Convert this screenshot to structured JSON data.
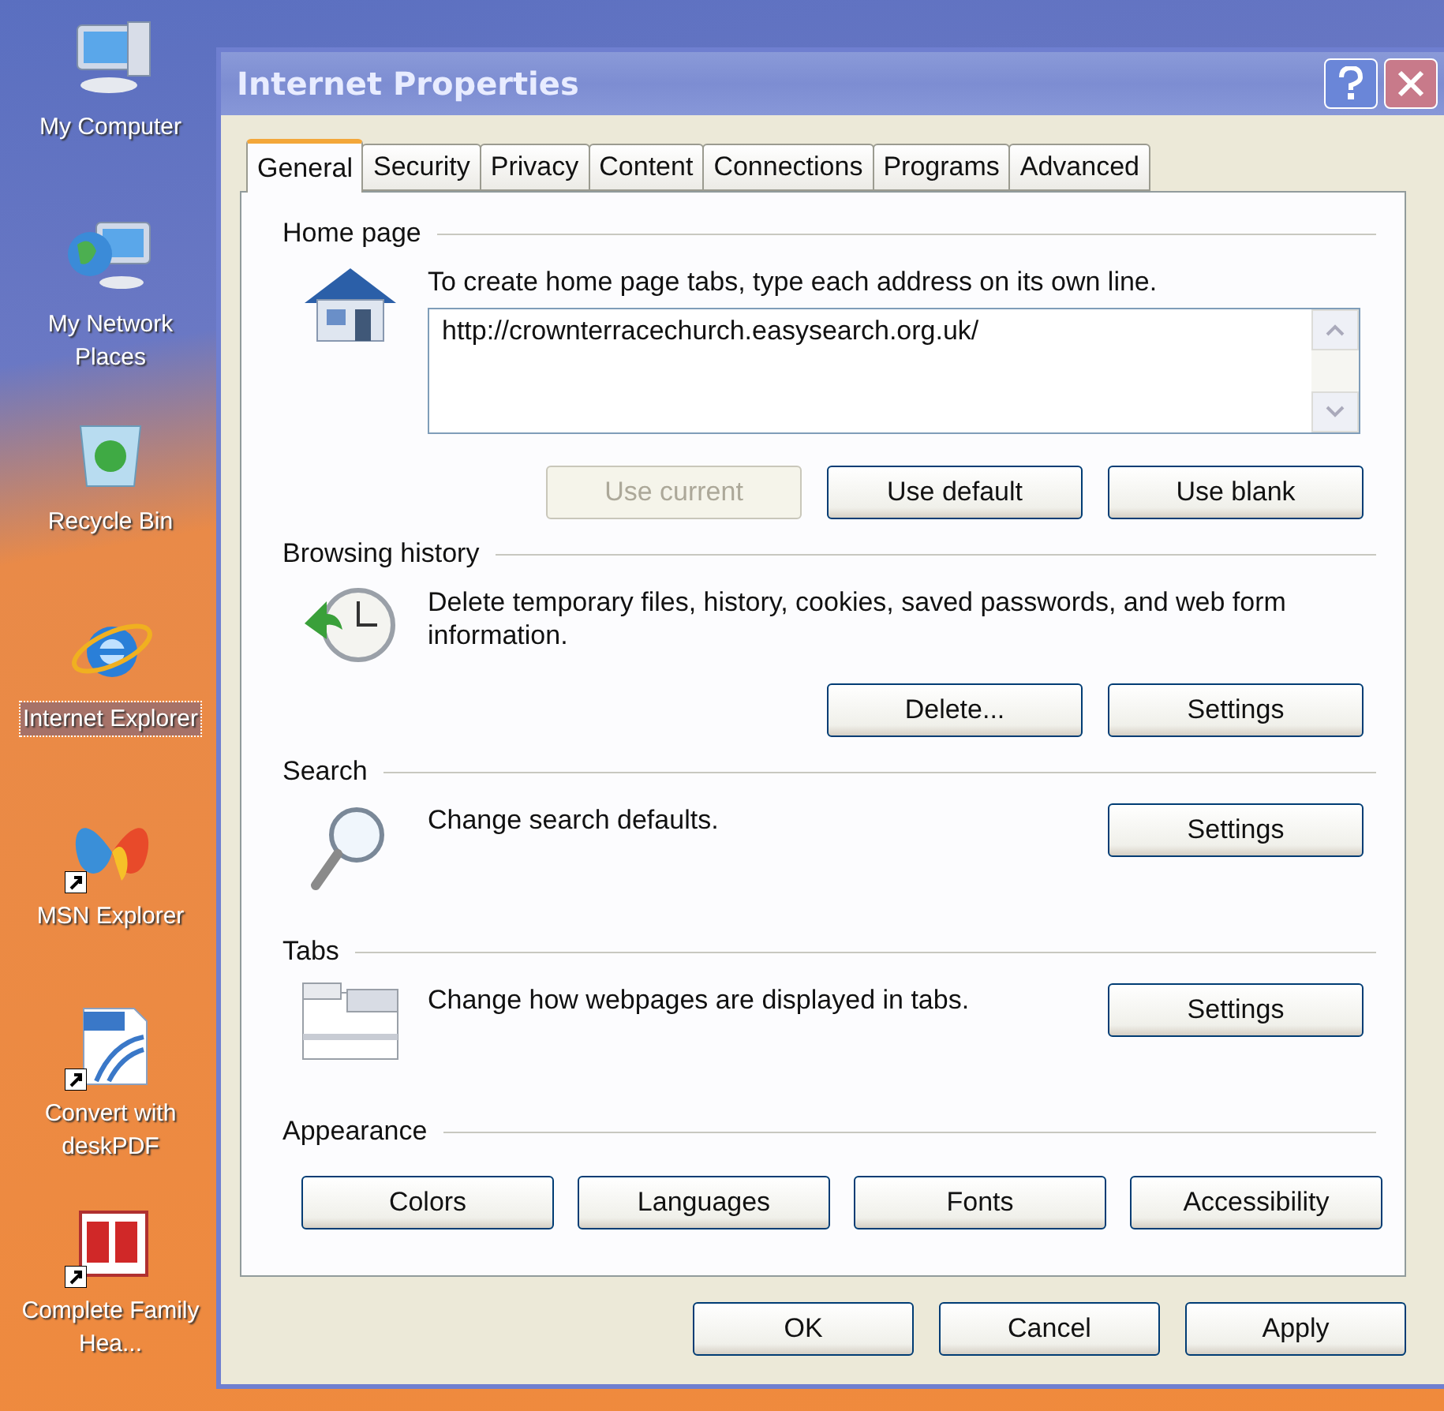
{
  "desktop": {
    "icons": [
      {
        "kind": "computer",
        "label": "My Computer",
        "shortcut": false,
        "selected": false
      },
      {
        "kind": "network",
        "label": "My Network Places",
        "shortcut": false,
        "selected": false
      },
      {
        "kind": "bin",
        "label": "Recycle Bin",
        "shortcut": false,
        "selected": false
      },
      {
        "kind": "browser",
        "label": "Internet Explorer",
        "shortcut": false,
        "selected": true
      },
      {
        "kind": "butterfly",
        "label": "MSN Explorer",
        "shortcut": true,
        "selected": false
      },
      {
        "kind": "pdf",
        "label": "Convert with deskPDF",
        "shortcut": true,
        "selected": false
      },
      {
        "kind": "book",
        "label": "Complete Family Hea...",
        "shortcut": true,
        "selected": false
      }
    ]
  },
  "window": {
    "title": "Internet Properties",
    "tabs": [
      {
        "label": "General",
        "selected": true
      },
      {
        "label": "Security",
        "selected": false
      },
      {
        "label": "Privacy",
        "selected": false
      },
      {
        "label": "Content",
        "selected": false
      },
      {
        "label": "Connections",
        "selected": false
      },
      {
        "label": "Programs",
        "selected": false
      },
      {
        "label": "Advanced",
        "selected": false
      }
    ],
    "sections": [
      {
        "kind": "home",
        "title": "Home page",
        "description": "To create home page tabs, type each address on its own line.",
        "value": "http://crownterracechurch.easysearch.org.uk/",
        "buttons": [
          {
            "label": "Use current",
            "disabled": true
          },
          {
            "label": "Use default",
            "disabled": false
          },
          {
            "label": "Use blank",
            "disabled": false
          }
        ]
      },
      {
        "kind": "history",
        "title": "Browsing history",
        "description": "Delete temporary files, history, cookies, saved passwords, and web form information.",
        "buttons": [
          {
            "label": "Delete...",
            "disabled": false
          },
          {
            "label": "Settings",
            "disabled": false
          }
        ]
      },
      {
        "kind": "search",
        "title": "Search",
        "description": "Change search defaults.",
        "buttons": [
          {
            "label": "Settings",
            "disabled": false
          }
        ]
      },
      {
        "kind": "tabs",
        "title": "Tabs",
        "description": "Change how webpages are displayed in tabs.",
        "buttons": [
          {
            "label": "Settings",
            "disabled": false
          }
        ]
      },
      {
        "kind": "appearance",
        "title": "Appearance",
        "buttons": [
          {
            "label": "Colors",
            "disabled": false
          },
          {
            "label": "Languages",
            "disabled": false
          },
          {
            "label": "Fonts",
            "disabled": false
          },
          {
            "label": "Accessibility",
            "disabled": false
          }
        ]
      }
    ],
    "buttons": [
      {
        "label": "OK",
        "disabled": false
      },
      {
        "label": "Cancel",
        "disabled": false
      },
      {
        "label": "Apply",
        "disabled": false
      }
    ]
  }
}
